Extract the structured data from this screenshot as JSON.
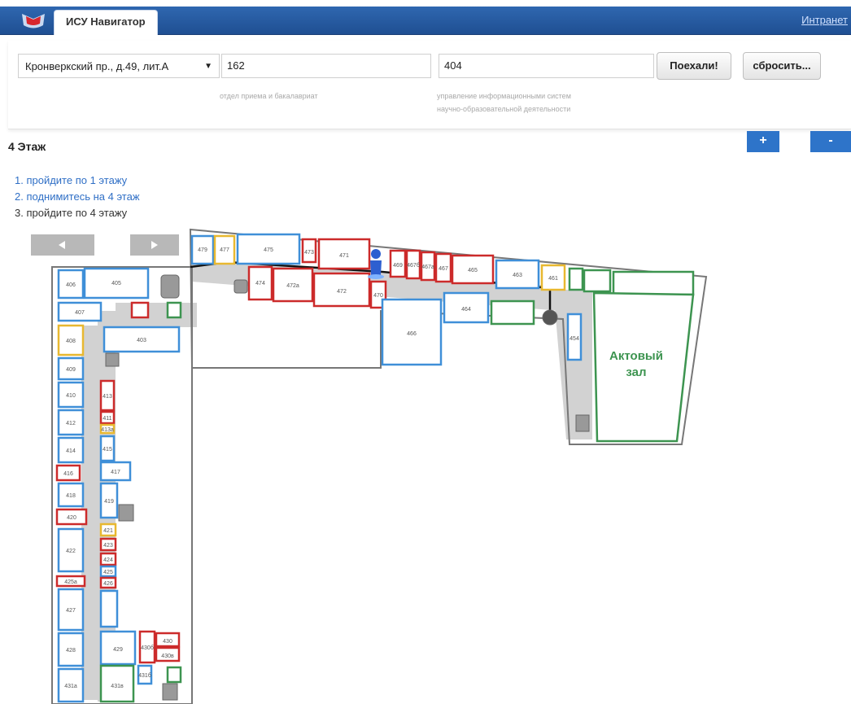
{
  "header": {
    "app_tab": "ИСУ Навигатор",
    "intranet_link": "Интранет"
  },
  "search": {
    "building": "Кронверкский пр., д.49, лит.А",
    "from_value": "162",
    "to_value": "404",
    "from_hint": "отдел приема и бакалавриат",
    "to_hint_line1": "управление информационными систем",
    "to_hint_line2": "научно-образовательной деятельности",
    "go_label": "Поехали!",
    "reset_label": "сбросить..."
  },
  "floor": {
    "title": "4 Этаж",
    "zoom_in": "+",
    "zoom_out": "-"
  },
  "route_steps": [
    "1. пройдите по 1 этажу",
    "2. поднимитесь на 4 этаж",
    "3. пройдите по 4 этажу"
  ],
  "map": {
    "hall_line1": "Актовый",
    "hall_line2": "зал",
    "rooms": {
      "r479": "479",
      "r477": "477",
      "r475": "475",
      "r473": "473",
      "r471": "471",
      "r469": "469",
      "r467b": "467б",
      "r467a": "467а",
      "r467": "467",
      "r465": "465",
      "r463": "463",
      "r461": "461",
      "r474": "474",
      "r472a": "472а",
      "r472": "472",
      "r470": "470",
      "r466": "466",
      "r464": "464",
      "r454": "454",
      "r406": "406",
      "r405": "405",
      "r407": "407",
      "r408": "408",
      "r403": "403",
      "r409": "409",
      "r410": "410",
      "r412": "412",
      "r414": "414",
      "r416": "416",
      "r418": "418",
      "r420": "420",
      "r422": "422",
      "r425a": "425а",
      "r427": "427",
      "r428": "428",
      "r431a": "431а",
      "r413": "413",
      "r413a": "413а",
      "r411": "411",
      "r415": "415",
      "r417": "417",
      "r419": "419",
      "r421": "421",
      "r423": "423",
      "r424": "424",
      "r425": "425",
      "r426": "426",
      "r429": "429",
      "r430": "430",
      "r430b": "430б",
      "r430v": "430в",
      "r431b": "431б",
      "r431v": "431в"
    }
  },
  "colors": {
    "blue_room": "#3f8fd8",
    "red_room": "#cc2b2b",
    "yellow_room": "#e8b830",
    "green_room": "#3d9450",
    "corridor": "#cfcfcf"
  }
}
